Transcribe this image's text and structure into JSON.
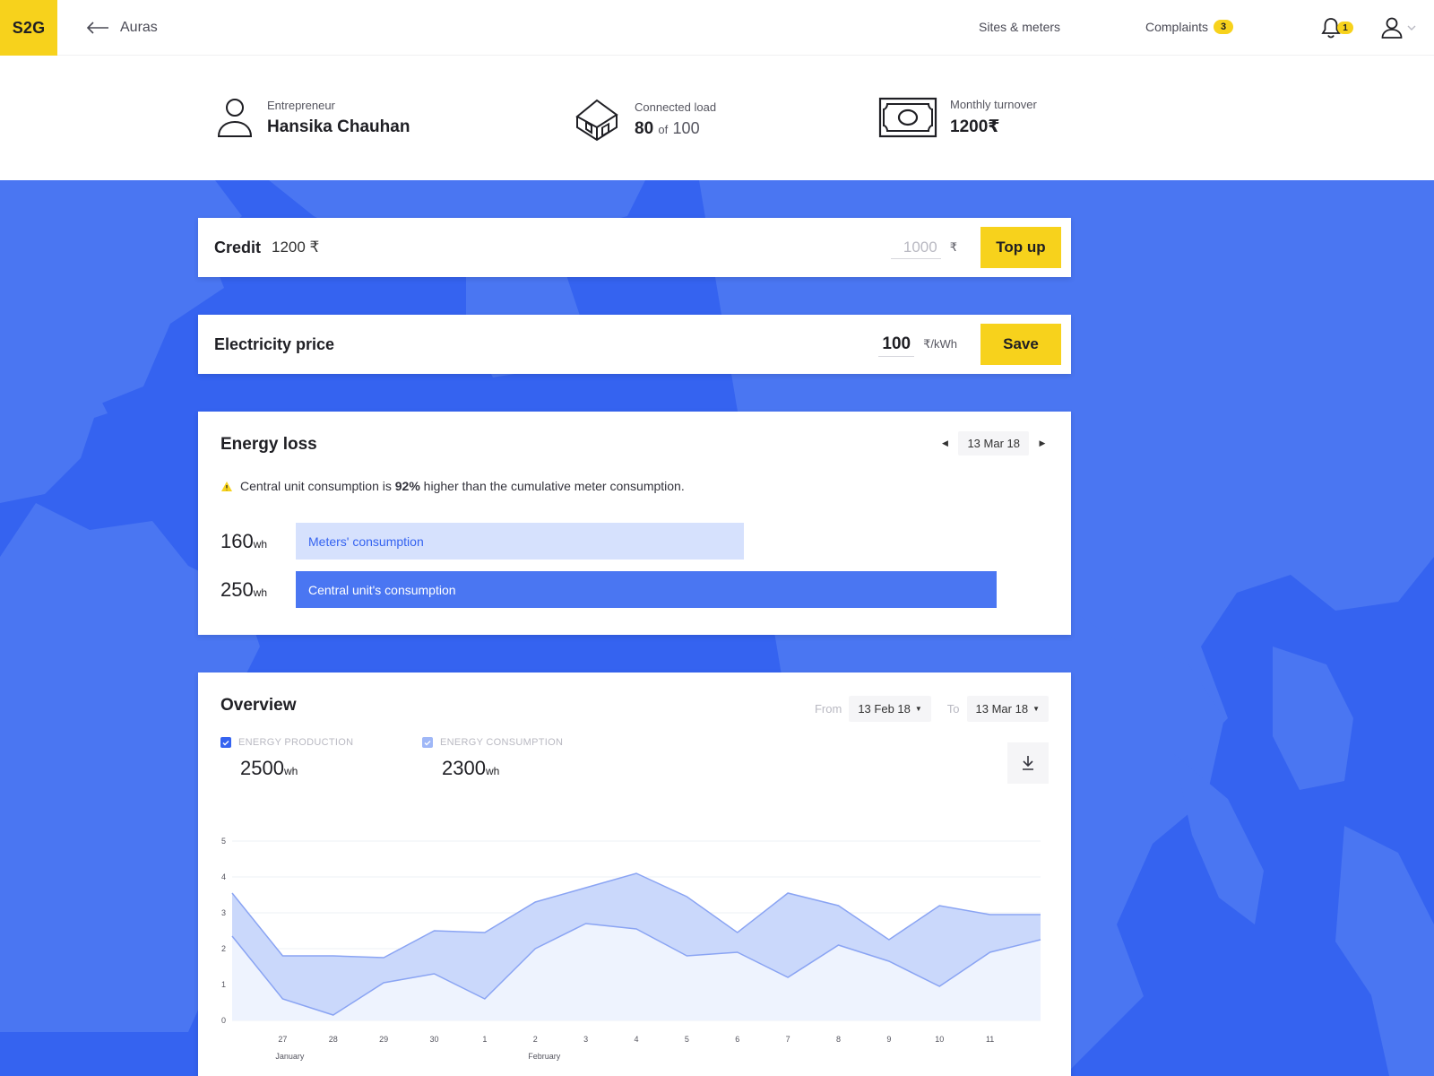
{
  "topbar": {
    "logo": "S2G",
    "back_label": "Auras",
    "nav": {
      "sites_meters": "Sites & meters",
      "complaints": "Complaints",
      "complaints_count": "3",
      "notifications_count": "1"
    }
  },
  "header": {
    "entrepreneur_label": "Entrepreneur",
    "entrepreneur_name": "Hansika Chauhan",
    "connected_load_label": "Connected load",
    "connected_load_value": "80",
    "connected_load_of": "of",
    "connected_load_total": "100",
    "monthly_turnover_label": "Monthly turnover",
    "monthly_turnover_value": "1200₹"
  },
  "credit": {
    "title": "Credit",
    "value": "1200 ₹",
    "amount_placeholder": "1000",
    "currency": "₹",
    "button": "Top up"
  },
  "price": {
    "title": "Electricity price",
    "value": "100",
    "unit": "₹/kWh",
    "button": "Save"
  },
  "energy_loss": {
    "title": "Energy loss",
    "date": "13 Mar 18",
    "warning_pre": "Central unit consumption is ",
    "warning_pct": "92%",
    "warning_post": " higher than the cumulative meter consumption.",
    "meters_value": "160",
    "meters_unit": "wh",
    "meters_label": "Meters' consumption",
    "meters_fill": 0.64,
    "central_value": "250",
    "central_unit": "wh",
    "central_label": "Central unit's consumption",
    "central_fill": 1.0
  },
  "overview": {
    "title": "Overview",
    "from_label": "From",
    "from_date": "13 Feb 18",
    "to_label": "To",
    "to_date": "13 Mar 18",
    "production_label": "ENERGY PRODUCTION",
    "production_value": "2500",
    "production_unit": "wh",
    "consumption_label": "ENERGY CONSUMPTION",
    "consumption_value": "2300",
    "consumption_unit": "wh"
  },
  "chart_data": {
    "type": "area",
    "x": [
      "",
      "27",
      "28",
      "29",
      "30",
      "1",
      "2",
      "3",
      "4",
      "5",
      "6",
      "7",
      "8",
      "9",
      "10",
      "11",
      ""
    ],
    "month_labels": [
      {
        "at": "27",
        "label": "January"
      },
      {
        "at": "2",
        "label": "February"
      }
    ],
    "ylim": [
      0,
      5
    ],
    "yticks": [
      "0",
      "1",
      "2",
      "3",
      "4",
      "5"
    ],
    "grid": true,
    "series": [
      {
        "values": [
          3.55,
          1.8,
          1.8,
          1.75,
          2.5,
          2.45,
          3.3,
          3.7,
          4.1,
          3.45,
          2.45,
          3.55,
          3.2,
          2.25,
          3.2,
          2.95,
          2.95
        ]
      },
      {
        "values": [
          2.35,
          0.6,
          0.15,
          1.05,
          1.3,
          0.6,
          2.0,
          2.7,
          2.55,
          1.8,
          1.9,
          1.2,
          2.1,
          1.65,
          0.95,
          1.9,
          2.25
        ]
      }
    ],
    "colors": {
      "upper_fill": "#cad8fb",
      "lower_fill": "#eef3fe",
      "line": "#8aa4f3"
    }
  }
}
